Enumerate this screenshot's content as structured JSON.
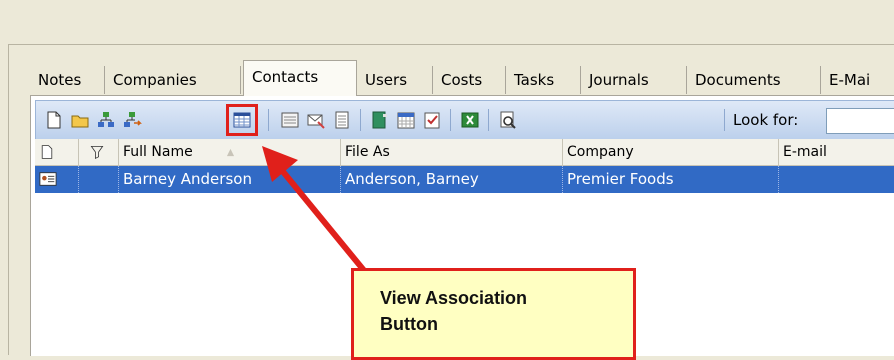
{
  "tabs": [
    "Notes",
    "Companies",
    "Contacts",
    "Users",
    "Costs",
    "Tasks",
    "Journals",
    "Documents",
    "E-Mai"
  ],
  "active_tab": "Contacts",
  "toolbar": {
    "look_for_label": "Look for:",
    "search_value": "",
    "icons": [
      "new-icon",
      "open-icon",
      "link-icon",
      "link-arrow-icon",
      "view-association-icon",
      "form-icon",
      "mail-icon",
      "list-icon",
      "phone-icon",
      "calendar-icon",
      "checklist-icon",
      "excel-icon",
      "find-icon"
    ]
  },
  "grid": {
    "columns": [
      "",
      "",
      "Full Name",
      "File As",
      "Company",
      "E-mail"
    ],
    "rows": [
      {
        "full_name": "Barney Anderson",
        "file_as": "Anderson, Barney",
        "company": "Premier Foods",
        "email": ""
      }
    ]
  },
  "callout": {
    "line1": "View Association",
    "line2": "Button"
  },
  "colors": {
    "highlight": "#e0201b",
    "selection": "#316ac5",
    "callout_bg": "#ffffc2"
  }
}
